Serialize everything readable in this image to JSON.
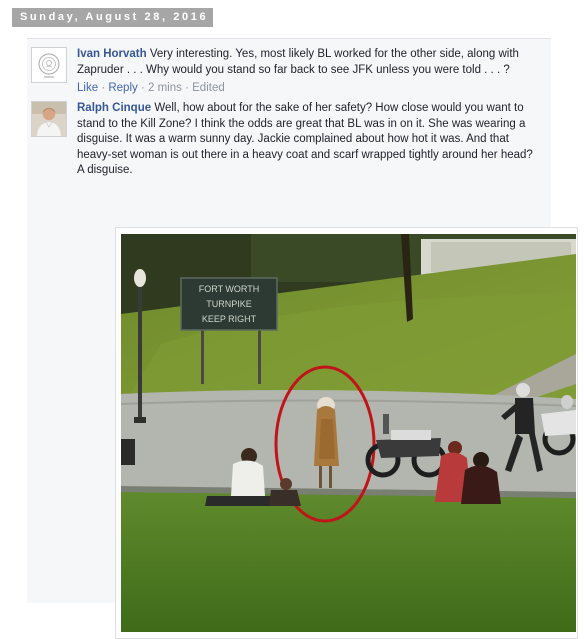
{
  "post": {
    "date_header": "Sunday, August 28, 2016"
  },
  "comments": [
    {
      "author": "Ivan Horvath",
      "text": "Very interesting. Yes, most likely BL worked for the other side, along with Zapruder . . . Why would you stand so far back to see JFK unless you were told . . . ?",
      "actions": {
        "like": "Like",
        "reply": "Reply",
        "time": "2 mins",
        "edited": "Edited",
        "separator": "·"
      }
    },
    {
      "author": "Ralph Cinque",
      "text": "Well, how about for the sake of her safety? How close would you want to stand to the Kill Zone? I think the odds are great that BL was in on it. She was wearing a disguise. It was a warm sunny day. Jackie complained about how hot it was. And that heavy-set woman is out there in a heavy coat and scarf wrapped tightly around her head? A disguise."
    }
  ],
  "photo": {
    "sign_lines": [
      "FORT WORTH",
      "TURNPIKE",
      "KEEP RIGHT"
    ],
    "highlight_color": "#c0141a"
  },
  "colors": {
    "author_link": "#365899",
    "action_link": "#4267b2",
    "meta_text": "#8d949e",
    "panel_bg": "#f6f7f9",
    "date_bar_bg": "#a6a6a6"
  }
}
